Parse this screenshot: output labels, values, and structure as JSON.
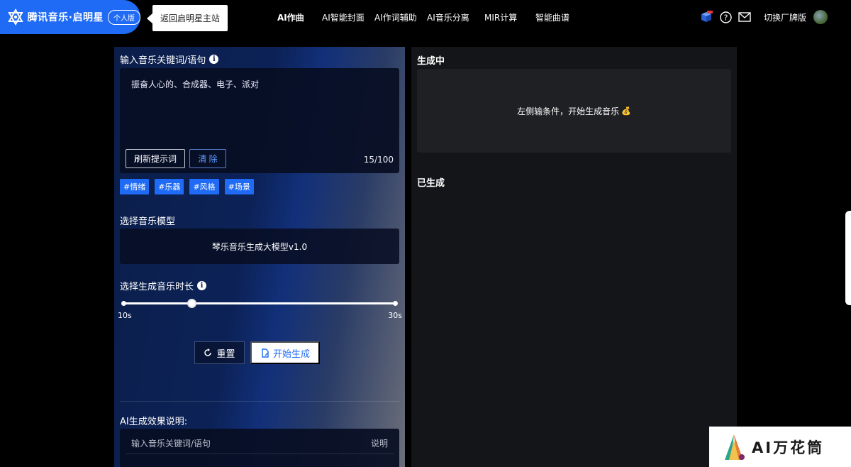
{
  "brand": {
    "name": "腾讯音乐·启明星",
    "badge": "个人版"
  },
  "back_tip": "返回启明星主站",
  "nav": [
    {
      "label": "AI作曲",
      "active": true
    },
    {
      "label": "AI智能封面",
      "active": false
    },
    {
      "label": "AI作词辅助",
      "active": false
    },
    {
      "label": "AI音乐分离",
      "active": false
    },
    {
      "label": "MIR计算",
      "active": false
    },
    {
      "label": "智能曲谱",
      "active": false
    }
  ],
  "header_right": {
    "switch_label": "切换厂牌版"
  },
  "left": {
    "input_label": "输入音乐关键词/语句",
    "prompt_value": "振奋人心的、合成器、电子、派对",
    "refresh_btn": "刷新提示词",
    "clear_btn": "清 除",
    "char_count": "15/100",
    "tags": [
      "#情绪",
      "#乐器",
      "#风格",
      "#场景"
    ],
    "model_label": "选择音乐模型",
    "model_value": "琴乐音乐生成大模型v1.0",
    "duration_label": "选择生成音乐时长",
    "slider": {
      "min_label": "10s",
      "max_label": "30s",
      "value_fraction": 0.25
    },
    "reset_btn": "重置",
    "start_btn": "开始生成",
    "explain_label": "AI生成效果说明:",
    "explain_cols": [
      "输入音乐关键词/语句",
      "说明"
    ]
  },
  "right": {
    "generating_label": "生成中",
    "generating_hint": "左侧输条件，开始生成音乐",
    "generated_label": "已生成"
  },
  "watermark": {
    "text": "AI万花筒"
  },
  "colors": {
    "accent": "#1f6bf5",
    "panel_dark": "#141518"
  }
}
